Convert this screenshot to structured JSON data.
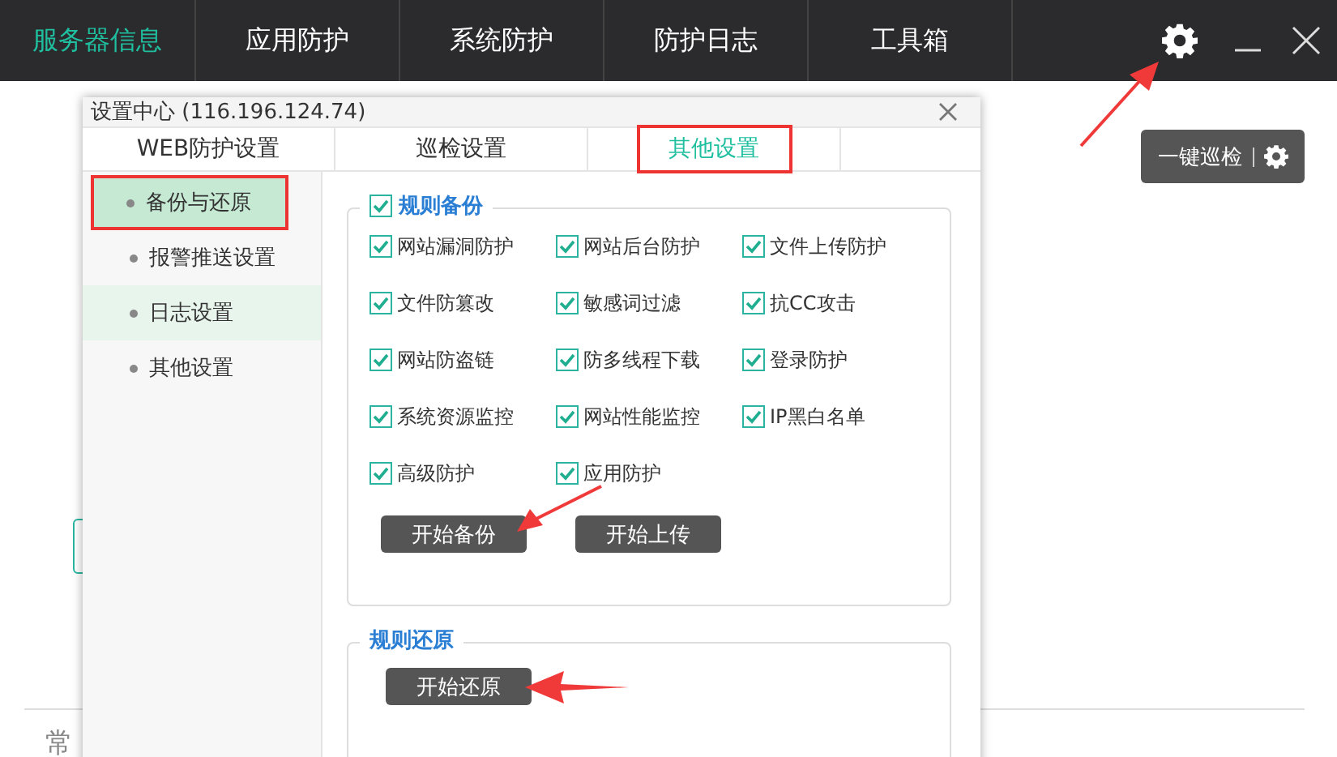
{
  "app": {
    "nav": [
      {
        "label": "服务器信息",
        "selected": true
      },
      {
        "label": "应用防护",
        "selected": false
      },
      {
        "label": "系统防护",
        "selected": false
      },
      {
        "label": "防护日志",
        "selected": false
      },
      {
        "label": "工具箱",
        "selected": false
      }
    ],
    "settings_annotated": true
  },
  "background": {
    "patrol_button": "一键巡检",
    "section_label": "常"
  },
  "dialog": {
    "title": "设置中心 (116.196.124.74)",
    "tabs": [
      {
        "label": "WEB防护设置",
        "selected": false,
        "highlighted": false
      },
      {
        "label": "巡检设置",
        "selected": false,
        "highlighted": false
      },
      {
        "label": "其他设置",
        "selected": true,
        "highlighted": true
      }
    ],
    "sidebar": [
      {
        "label": "备份与还原",
        "selected": true,
        "hovered": false,
        "highlighted": true
      },
      {
        "label": "报警推送设置",
        "selected": false,
        "hovered": false,
        "highlighted": false
      },
      {
        "label": "日志设置",
        "selected": false,
        "hovered": true,
        "highlighted": false
      },
      {
        "label": "其他设置",
        "selected": false,
        "hovered": false,
        "highlighted": false
      }
    ],
    "backup": {
      "title": "规则备份",
      "checked": true,
      "options": [
        {
          "label": "网站漏洞防护",
          "checked": true
        },
        {
          "label": "网站后台防护",
          "checked": true
        },
        {
          "label": "文件上传防护",
          "checked": true
        },
        {
          "label": "文件防篡改",
          "checked": true
        },
        {
          "label": "敏感词过滤",
          "checked": true
        },
        {
          "label": "抗CC攻击",
          "checked": true
        },
        {
          "label": "网站防盗链",
          "checked": true
        },
        {
          "label": "防多线程下载",
          "checked": true
        },
        {
          "label": "登录防护",
          "checked": true
        },
        {
          "label": "系统资源监控",
          "checked": true
        },
        {
          "label": "网站性能监控",
          "checked": true
        },
        {
          "label": "IP黑白名单",
          "checked": true
        },
        {
          "label": "高级防护",
          "checked": true
        },
        {
          "label": "应用防护",
          "checked": true
        }
      ],
      "buttons": [
        {
          "label": "开始备份",
          "annotated": true
        },
        {
          "label": "开始上传",
          "annotated": false
        }
      ]
    },
    "restore": {
      "title": "规则还原",
      "buttons": [
        {
          "label": "开始还原",
          "annotated": true
        }
      ]
    }
  }
}
